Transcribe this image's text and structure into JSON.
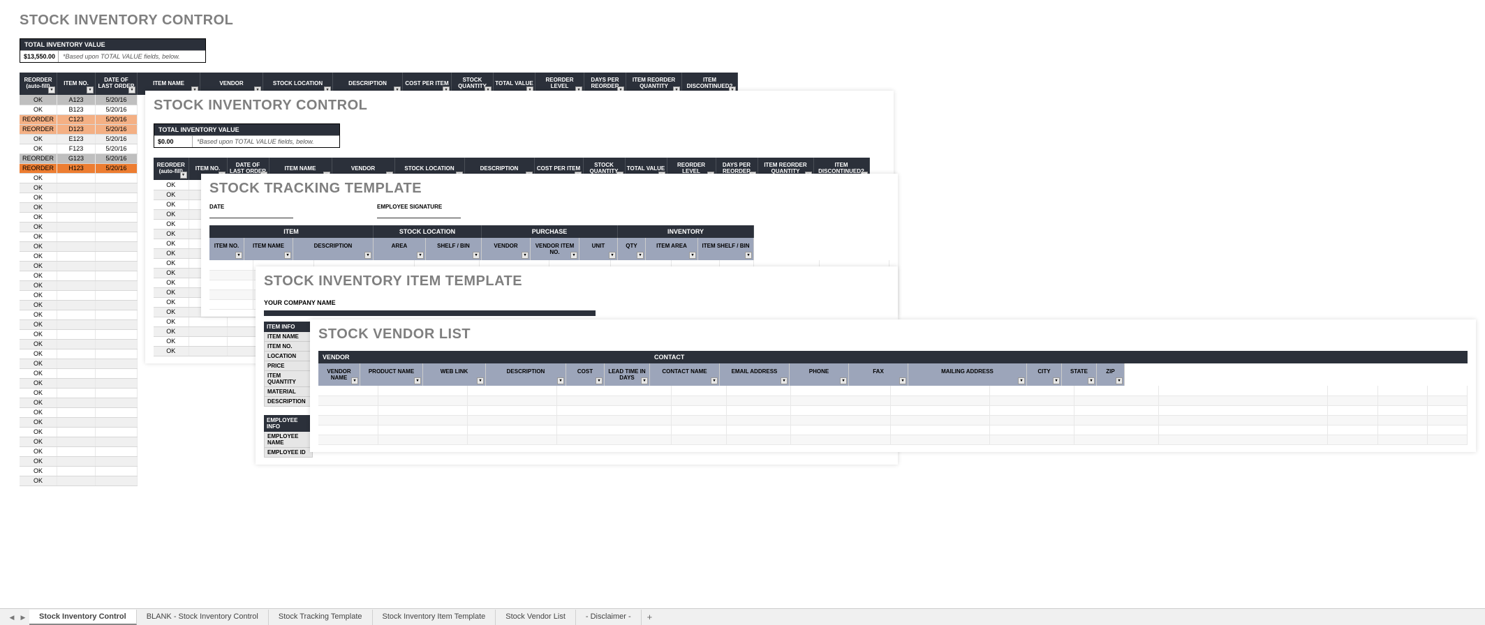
{
  "sheet1": {
    "title": "STOCK INVENTORY CONTROL",
    "tiv_label": "TOTAL INVENTORY VALUE",
    "tiv_value": "$13,550.00",
    "tiv_note": "*Based upon TOTAL VALUE fields, below.",
    "headers": [
      "REORDER (auto-fill)",
      "ITEM NO.",
      "DATE OF LAST ORDER",
      "ITEM NAME",
      "VENDOR",
      "STOCK LOCATION",
      "DESCRIPTION",
      "COST PER ITEM",
      "STOCK QUANTITY",
      "TOTAL VALUE",
      "REORDER LEVEL",
      "DAYS PER REORDER",
      "ITEM REORDER QUANTITY",
      "ITEM DISCONTINUED?"
    ],
    "rows": [
      {
        "status": "OK",
        "item": "A123",
        "date": "5/20/16",
        "style": "gray"
      },
      {
        "status": "OK",
        "item": "B123",
        "date": "5/20/16",
        "style": ""
      },
      {
        "status": "REORDER",
        "item": "C123",
        "date": "5/20/16",
        "style": "orange"
      },
      {
        "status": "REORDER",
        "item": "D123",
        "date": "5/20/16",
        "style": "orange"
      },
      {
        "status": "OK",
        "item": "E123",
        "date": "5/20/16",
        "style": ""
      },
      {
        "status": "OK",
        "item": "F123",
        "date": "5/20/16",
        "style": ""
      },
      {
        "status": "REORDER",
        "item": "G123",
        "date": "5/20/16",
        "style": "gray"
      },
      {
        "status": "REORDER",
        "item": "H123",
        "date": "5/20/16",
        "style": "orangedark"
      }
    ],
    "ok_text": "OK",
    "extra_ok_count": 32
  },
  "sheet2": {
    "title": "STOCK INVENTORY CONTROL",
    "tiv_label": "TOTAL INVENTORY VALUE",
    "tiv_value": "$0.00",
    "tiv_note": "*Based upon TOTAL VALUE fields, below.",
    "headers": [
      "REORDER (auto-fill)",
      "ITEM NO.",
      "DATE OF LAST ORDER",
      "ITEM NAME",
      "VENDOR",
      "STOCK LOCATION",
      "DESCRIPTION",
      "COST PER ITEM",
      "STOCK QUANTITY",
      "TOTAL VALUE",
      "REORDER LEVEL",
      "DAYS PER REORDER",
      "ITEM REORDER QUANTITY",
      "ITEM DISCONTINUED?"
    ],
    "ok_text": "OK",
    "ok_count": 18
  },
  "sheet3": {
    "title": "STOCK TRACKING TEMPLATE",
    "date_label": "DATE",
    "emp_sig_label": "EMPLOYEE SIGNATURE",
    "bands": [
      "ITEM",
      "STOCK LOCATION",
      "PURCHASE",
      "INVENTORY"
    ],
    "subheaders": [
      "ITEM NO.",
      "ITEM NAME",
      "DESCRIPTION",
      "AREA",
      "SHELF / BIN",
      "VENDOR",
      "VENDOR ITEM NO.",
      "UNIT",
      "QTY",
      "ITEM AREA",
      "ITEM SHELF / BIN"
    ]
  },
  "sheet4": {
    "title": "STOCK INVENTORY ITEM TEMPLATE",
    "company_label": "YOUR COMPANY NAME",
    "item_info_hdr": "ITEM INFO",
    "item_info_rows": [
      "ITEM NAME",
      "ITEM NO.",
      "LOCATION",
      "PRICE",
      "ITEM QUANTITY",
      "MATERIAL",
      "DESCRIPTION"
    ],
    "emp_info_hdr": "EMPLOYEE INFO",
    "emp_info_rows": [
      "EMPLOYEE NAME",
      "EMPLOYEE ID"
    ]
  },
  "sheet5": {
    "title": "STOCK VENDOR LIST",
    "band1": "VENDOR",
    "band2": "CONTACT",
    "subheaders": [
      "VENDOR NAME",
      "PRODUCT NAME",
      "WEB LINK",
      "DESCRIPTION",
      "COST",
      "LEAD TIME IN DAYS",
      "CONTACT NAME",
      "EMAIL ADDRESS",
      "PHONE",
      "FAX",
      "MAILING ADDRESS",
      "CITY",
      "STATE",
      "ZIP"
    ]
  },
  "tabs": {
    "items": [
      "Stock Inventory Control",
      "BLANK - Stock Inventory Control",
      "Stock Tracking Template",
      "Stock Inventory Item Template",
      "Stock Vendor List",
      "- Disclaimer -"
    ],
    "add": "+"
  }
}
